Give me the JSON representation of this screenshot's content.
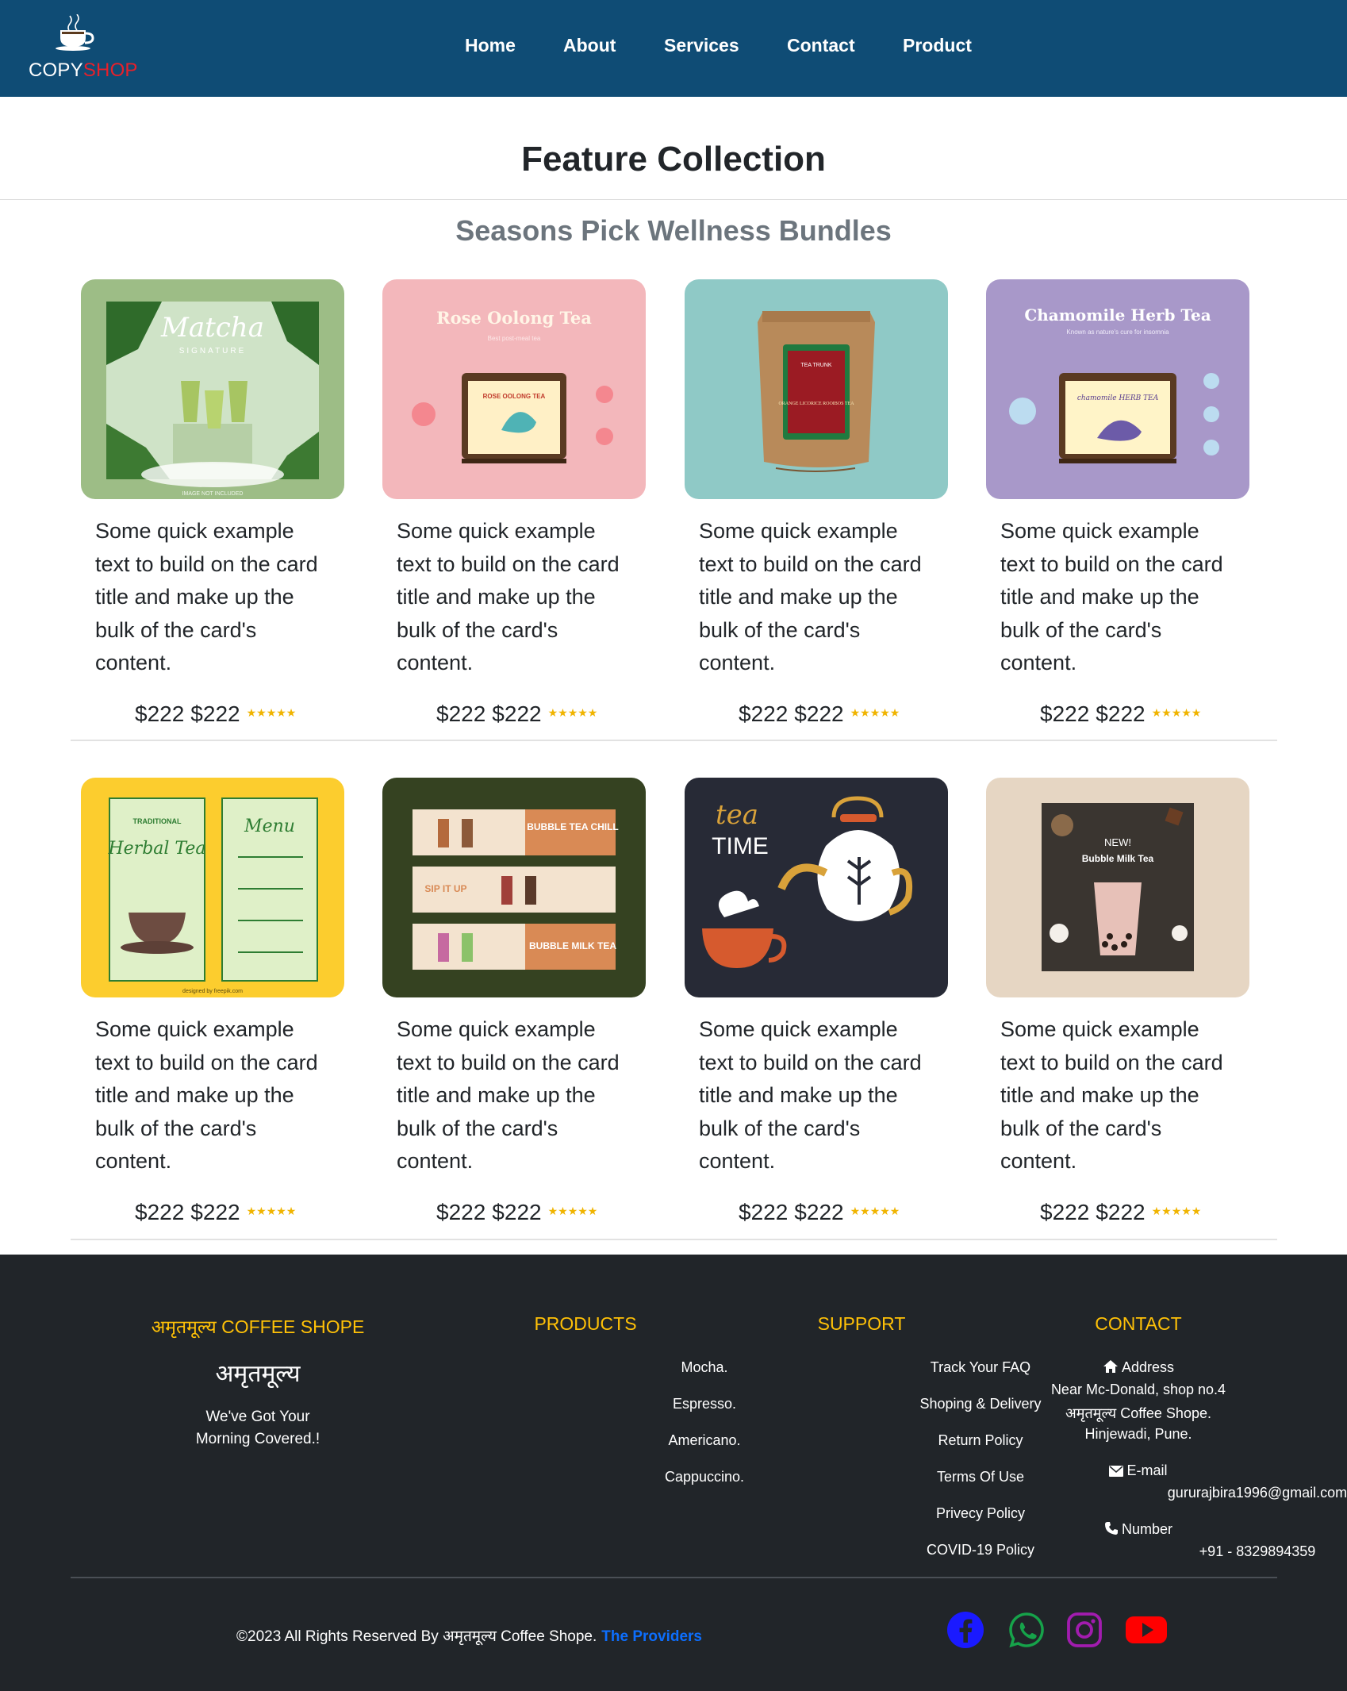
{
  "brand": {
    "logo_text_main": "COPY",
    "logo_text_accent": "SHOP",
    "accent_color": "#e8202a",
    "nav_bg": "#0f4c75",
    "cup_icon": "coffee-cup-icon"
  },
  "nav": {
    "items": [
      "Home",
      "About",
      "Services",
      "Contact",
      "Product"
    ]
  },
  "page": {
    "title": "Feature Collection",
    "subtitle": "Seasons Pick Wellness Bundles"
  },
  "cards": [
    {
      "image_title": "Matcha",
      "image_subtitle": "SIGNATURE",
      "image_note": "IMAGE NOT INCLUDED",
      "bg": "#9dbd86",
      "text": "Some quick example text to build on the card title and make up the bulk of the card's content.",
      "price1": "$222",
      "price2": "$222",
      "stars": "★★★★★"
    },
    {
      "image_title": "Rose Oolong Tea",
      "image_subtitle": "Best post-meal tea",
      "image_label": "ROSE OOLONG TEA",
      "bg": "#f3b7bb",
      "text": "Some quick example text to build on the card title and make up the bulk of the card's content.",
      "price1": "$222",
      "price2": "$222",
      "stars": "★★★★★"
    },
    {
      "image_title": "TEA TRUNK",
      "image_subtitle": "ORANGE LICORICE ROOIBOS TEA",
      "bg": "#8fc9c6",
      "text": "Some quick example text to build on the card title and make up the bulk of the card's content.",
      "price1": "$222",
      "price2": "$222",
      "stars": "★★★★★"
    },
    {
      "image_title": "Chamomile Herb Tea",
      "image_subtitle": "Known as nature's cure for insomnia",
      "image_label": "chamomile HERB TEA",
      "bg": "#a898c9",
      "text": "Some quick example text to build on the card title and make up the bulk of the card's content.",
      "price1": "$222",
      "price2": "$222",
      "stars": "★★★★★"
    },
    {
      "image_title": "Herbal Tea",
      "image_subtitle": "TRADITIONAL",
      "image_label": "Menu",
      "image_note": "designed by freepik.com",
      "bg": "#fccd2e",
      "text": "Some quick example text to build on the card title and make up the bulk of the card's content.",
      "price1": "$222",
      "price2": "$222",
      "stars": "★★★★★"
    },
    {
      "image_title": "BUBBLE TEA CHILL",
      "image_subtitle": "SIP IT UP",
      "image_label": "BUBBLE MILK TEA",
      "bg": "#354221",
      "text": "Some quick example text to build on the card title and make up the bulk of the card's content.",
      "price1": "$222",
      "price2": "$222",
      "stars": "★★★★★"
    },
    {
      "image_title": "tea",
      "image_subtitle": "TIME",
      "bg": "#272a36",
      "text": "Some quick example text to build on the card title and make up the bulk of the card's content.",
      "price1": "$222",
      "price2": "$222",
      "stars": "★★★★★"
    },
    {
      "image_title": "NEW!",
      "image_subtitle": "Bubble Milk Tea",
      "bg": "#e6d6c3",
      "text": "Some quick example text to build on the card title and make up the bulk of the card's content.",
      "price1": "$222",
      "price2": "$222",
      "stars": "★★★★★"
    }
  ],
  "footer": {
    "brand_heading": "अमृतमूल्य COFFEE SHOPE",
    "brand_name": "अमृतमूल्य",
    "tagline_line1": "We've Got Your",
    "tagline_line2": "Morning Covered.!",
    "products_heading": "PRODUCTS",
    "products": [
      "Mocha.",
      "Espresso.",
      "Americano.",
      "Cappuccino."
    ],
    "support_heading": "SUPPORT",
    "support": [
      "Track Your FAQ",
      "Shoping & Delivery",
      "Return Policy",
      "Terms Of Use",
      "Privecy Policy",
      "COVID-19 Policy"
    ],
    "contact_heading": "CONTACT",
    "address_label": "Address",
    "address_lines": [
      "Near Mc-Donald, shop no.4",
      "अमृतमूल्य Coffee Shope.",
      "Hinjewadi, Pune."
    ],
    "email_label": "E-mail",
    "email": "gururajbira1996@gmail.com",
    "phone_label": "Number",
    "phone": "+91 - 8329894359",
    "copyright": "©2023 All Rights Reserved By अमृतमूल्य Coffee Shope.",
    "providers": "The Providers",
    "heading_color": "#ffc107",
    "social": [
      {
        "name": "facebook-icon",
        "color": "#1a1aff"
      },
      {
        "name": "whatsapp-icon",
        "color": "#16a34a"
      },
      {
        "name": "instagram-icon",
        "color": "#a21caf"
      },
      {
        "name": "youtube-icon",
        "color": "#ff0000"
      }
    ]
  }
}
